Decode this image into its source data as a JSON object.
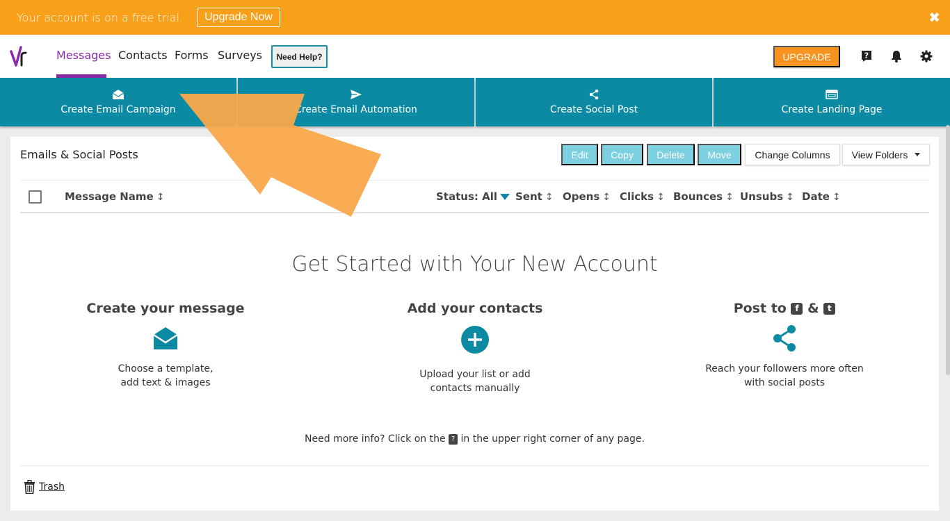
{
  "trial_banner": {
    "text": "Your account is on a free trial.",
    "upgrade_label": "Upgrade Now",
    "close_glyph": "✖"
  },
  "nav": {
    "links": [
      "Messages",
      "Contacts",
      "Forms",
      "Surveys"
    ],
    "active": "Messages",
    "need_help": "Need Help?",
    "upgrade": "UPGRADE",
    "accent": "#8b2aa6",
    "icons": [
      "help-icon",
      "bell-icon",
      "gear-icon"
    ]
  },
  "tiles": [
    {
      "label": "Create Email Campaign",
      "icon": "envelope-open-icon"
    },
    {
      "label": "Create Email Automation",
      "icon": "paper-plane-icon"
    },
    {
      "label": "Create Social Post",
      "icon": "share-icon"
    },
    {
      "label": "Create Landing Page",
      "icon": "browser-window-icon"
    }
  ],
  "panel": {
    "title": "Emails & Social Posts",
    "toolbar": {
      "edit": "Edit",
      "copy": "Copy",
      "delete": "Delete",
      "move": "Move",
      "change_columns": "Change Columns",
      "view_folders": "View Folders"
    },
    "columns": {
      "message_name": "Message Name",
      "status": "Status: All",
      "sent": "Sent",
      "opens": "Opens",
      "clicks": "Clicks",
      "bounces": "Bounces",
      "unsubs": "Unsubs",
      "date": "Date"
    },
    "sort_glyph": "↕",
    "get_started": "Get Started with Your New Account",
    "steps": {
      "message_title": "Create your message",
      "message_text_1": "Choose a template,",
      "message_text_2": "add text & images",
      "contacts_title": "Add your contacts",
      "contacts_text_1": "Upload your list or add",
      "contacts_text_2": "contacts manually",
      "post_title_prefix": "Post to",
      "post_title_amp": "&",
      "post_text_1": "Reach your followers more often",
      "post_text_2": "with social posts"
    },
    "more_info_prefix": "Need more info? Click on the",
    "more_info_suffix": "in the upper right corner of any page.",
    "trash": "Trash"
  },
  "colors": {
    "banner": "#f9a01b",
    "tile": "#0d8aa3",
    "disabled_button": "#7dd0df",
    "upgrade": "#f7931e"
  }
}
